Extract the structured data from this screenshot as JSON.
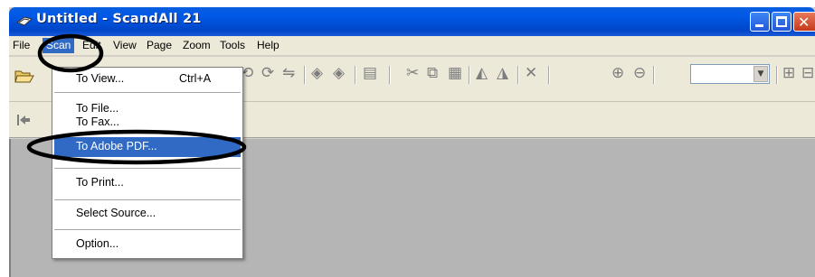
{
  "window": {
    "title": "Untitled - ScandAll 21"
  },
  "menubar": {
    "items": [
      "File",
      "Scan",
      "Edit",
      "View",
      "Page",
      "Zoom",
      "Tools",
      "Help"
    ],
    "active": "Scan"
  },
  "scan_menu": {
    "items": [
      {
        "label": "To View...",
        "shortcut": "Ctrl+A"
      },
      {
        "label": "To File..."
      },
      {
        "label": "To Fax..."
      },
      {
        "label": "To Adobe PDF...",
        "highlighted": true
      },
      {
        "label": "To Print..."
      },
      {
        "label": "Select Source..."
      },
      {
        "label": "Option..."
      }
    ]
  },
  "colors": {
    "titlebar": "#0058e6",
    "highlight": "#316ac5",
    "annotation": "#000000",
    "workspace": "#b5b5b5"
  },
  "icons": [
    "window-app-icon",
    "open-folder-icon",
    "toolbar-back-icon"
  ]
}
